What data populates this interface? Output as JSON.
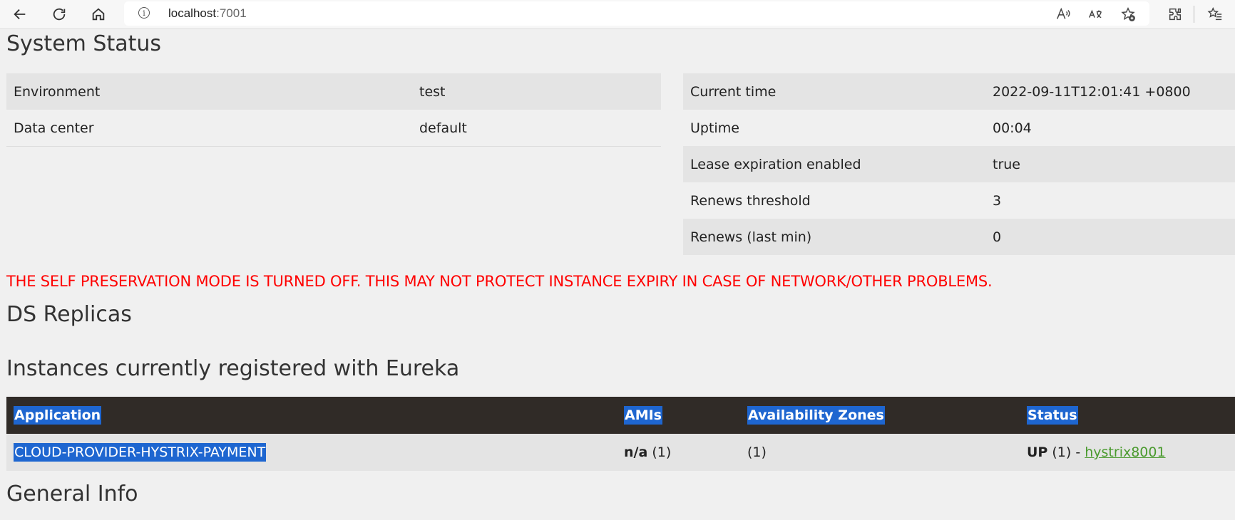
{
  "browser": {
    "url_host": "localhost",
    "url_port": ":7001",
    "info_icon_glyph": "i",
    "icons": [
      "back-icon",
      "refresh-icon",
      "home-icon",
      "info-icon",
      "read-aloud-icon",
      "translate-icon",
      "add-favorite-icon",
      "extensions-icon",
      "favorites-icon"
    ]
  },
  "system_status": {
    "heading": "System Status",
    "left_rows": [
      {
        "label": "Environment",
        "value": "test"
      },
      {
        "label": "Data center",
        "value": "default"
      }
    ],
    "right_rows": [
      {
        "label": "Current time",
        "value": "2022-09-11T12:01:41 +0800"
      },
      {
        "label": "Uptime",
        "value": "00:04"
      },
      {
        "label": "Lease expiration enabled",
        "value": "true"
      },
      {
        "label": "Renews threshold",
        "value": "3"
      },
      {
        "label": "Renews (last min)",
        "value": "0"
      }
    ]
  },
  "warning": "THE SELF PRESERVATION MODE IS TURNED OFF. THIS MAY NOT PROTECT INSTANCE EXPIRY IN CASE OF NETWORK/OTHER PROBLEMS.",
  "ds_replicas": {
    "heading": "DS Replicas"
  },
  "instances": {
    "heading": "Instances currently registered with Eureka",
    "columns": [
      "Application",
      "AMIs",
      "Availability Zones",
      "Status"
    ],
    "rows": [
      {
        "application": "CLOUD-PROVIDER-HYSTRIX-PAYMENT",
        "amis_bold": "n/a",
        "amis_count": " (1)",
        "zones": "(1)",
        "status_bold": "UP",
        "status_count": " (1) - ",
        "status_link": "hystrix8001"
      }
    ]
  },
  "general_info": {
    "heading": "General Info"
  },
  "colors": {
    "warning": "#ff0000",
    "table_header_bg": "#302b27",
    "selection": "#1e66d0",
    "link": "#4a9a2e"
  }
}
